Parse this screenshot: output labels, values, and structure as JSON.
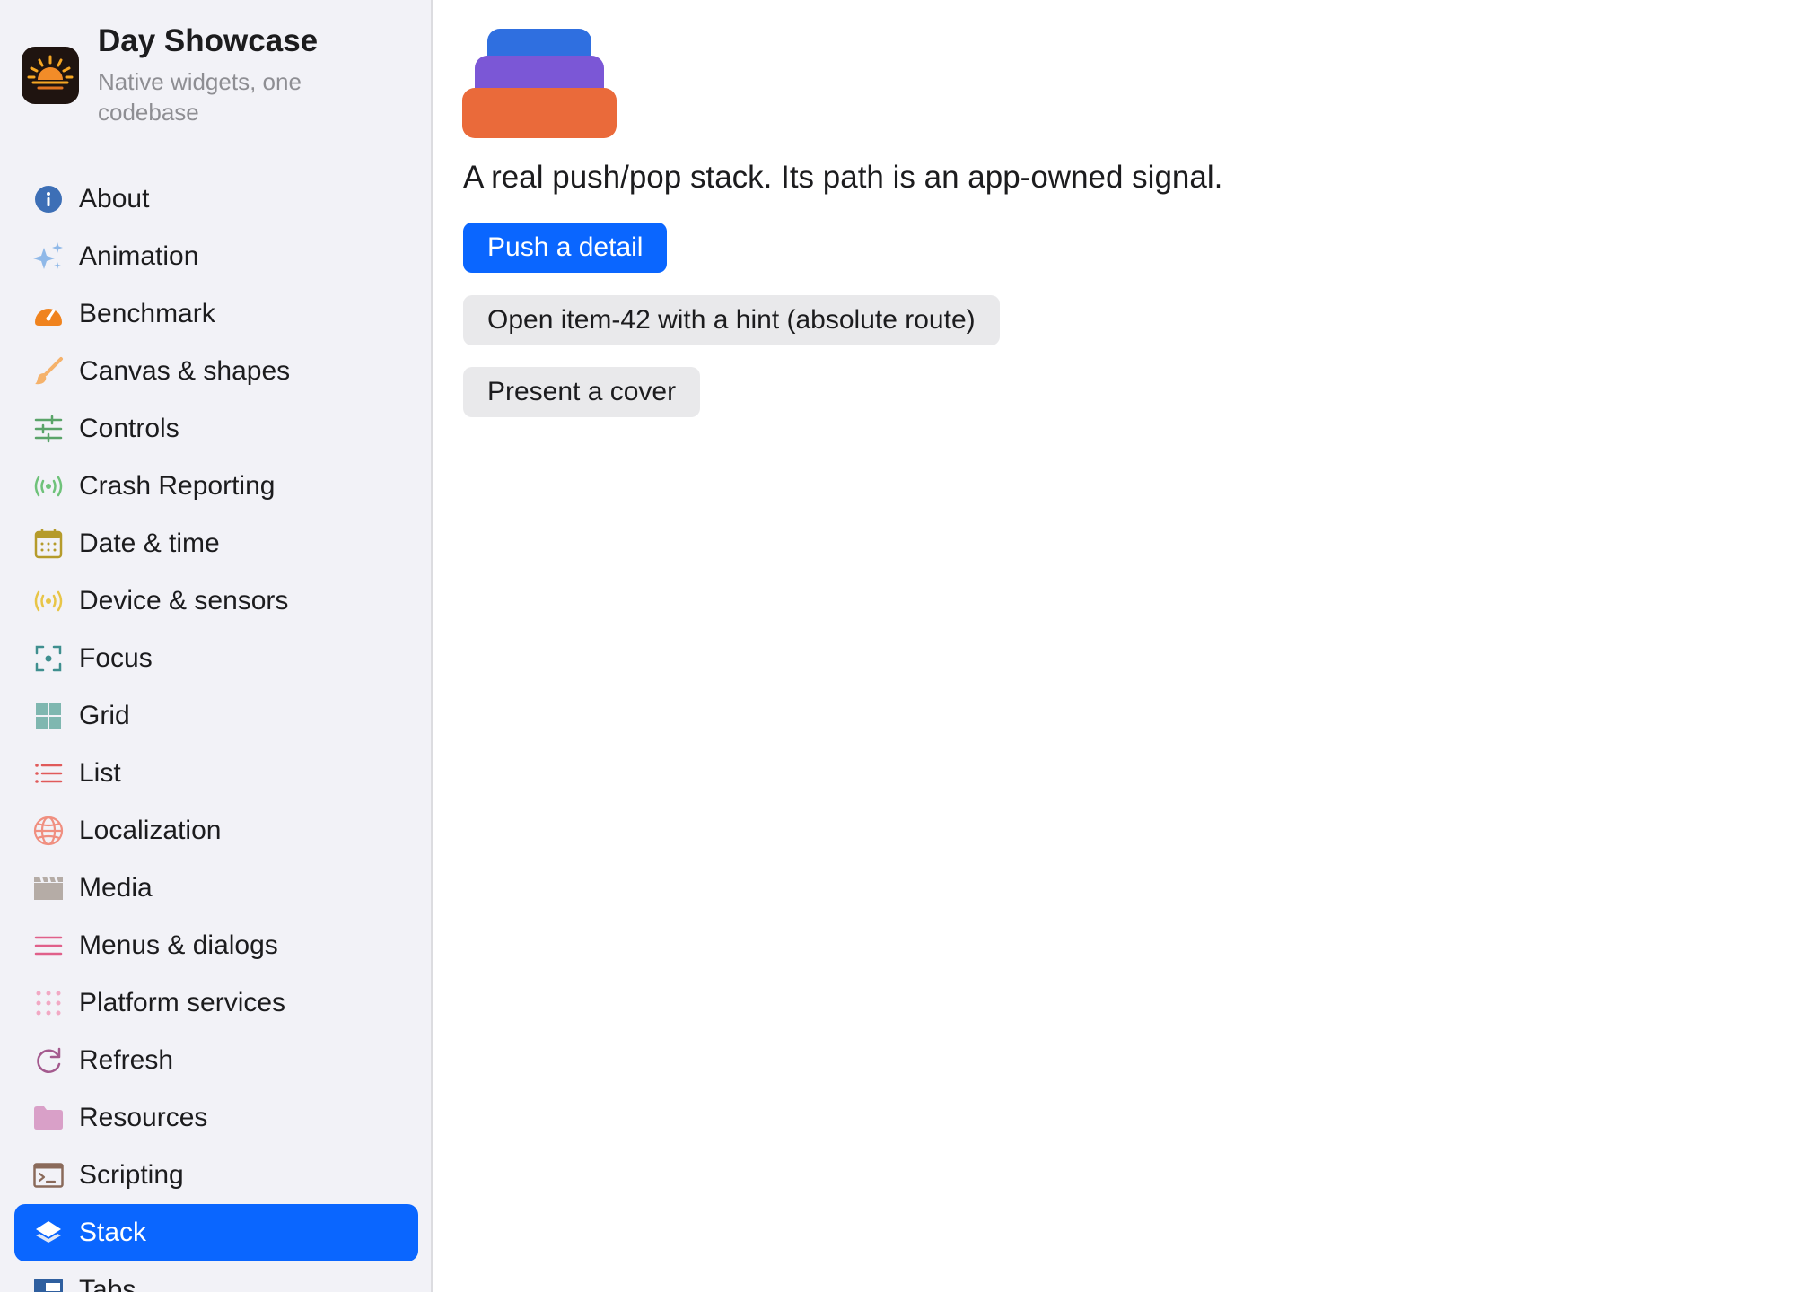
{
  "app": {
    "title": "Day Showcase",
    "subtitle": "Native widgets, one codebase",
    "icon": "sunrise-icon"
  },
  "sidebar": {
    "selected_index": 18,
    "items": [
      {
        "label": "About",
        "icon": "info-icon",
        "color": "#3d6fb6"
      },
      {
        "label": "Animation",
        "icon": "sparkles-icon",
        "color": "#8fb8e8"
      },
      {
        "label": "Benchmark",
        "icon": "speedometer-icon",
        "color": "#f0831e"
      },
      {
        "label": "Canvas & shapes",
        "icon": "paintbrush-icon",
        "color": "#f5b26b"
      },
      {
        "label": "Controls",
        "icon": "sliders-icon",
        "color": "#5aa469"
      },
      {
        "label": "Crash Reporting",
        "icon": "broadcast-icon",
        "color": "#6fc27a"
      },
      {
        "label": "Date & time",
        "icon": "calendar-icon",
        "color": "#b59b2b"
      },
      {
        "label": "Device & sensors",
        "icon": "sensor-icon",
        "color": "#e8c547"
      },
      {
        "label": "Focus",
        "icon": "focus-viewfinder-icon",
        "color": "#3f8f8f"
      },
      {
        "label": "Grid",
        "icon": "grid-icon",
        "color": "#7fb7b0"
      },
      {
        "label": "List",
        "icon": "list-icon",
        "color": "#e05a5a"
      },
      {
        "label": "Localization",
        "icon": "globe-icon",
        "color": "#f08f80"
      },
      {
        "label": "Media",
        "icon": "film-icon",
        "color": "#b5aca6"
      },
      {
        "label": "Menus & dialogs",
        "icon": "menu-lines-icon",
        "color": "#e0608a"
      },
      {
        "label": "Platform services",
        "icon": "dots-grid-icon",
        "color": "#f2a9c4"
      },
      {
        "label": "Refresh",
        "icon": "refresh-icon",
        "color": "#a45a8e"
      },
      {
        "label": "Resources",
        "icon": "folder-icon",
        "color": "#d9a0c8"
      },
      {
        "label": "Scripting",
        "icon": "terminal-icon",
        "color": "#8a6a5a"
      },
      {
        "label": "Stack",
        "icon": "layers-icon",
        "color": "#ffffff"
      },
      {
        "label": "Tabs",
        "icon": "tabs-icon",
        "color": "#2f5f9f"
      }
    ]
  },
  "main": {
    "illustration": {
      "name": "stack-layers-illustration",
      "colors": [
        "#2f6fe0",
        "#7b57d6",
        "#ea6a3a"
      ]
    },
    "description": "A real push/pop stack. Its path is an app-owned signal.",
    "buttons": {
      "push": "Push a detail",
      "open_hint": "Open item-42 with a hint (absolute route)",
      "cover": "Present a cover"
    }
  },
  "colors": {
    "accent": "#0a66ff",
    "sidebar_bg": "#f2f2f7",
    "secondary_button_bg": "#e9e9eb"
  }
}
